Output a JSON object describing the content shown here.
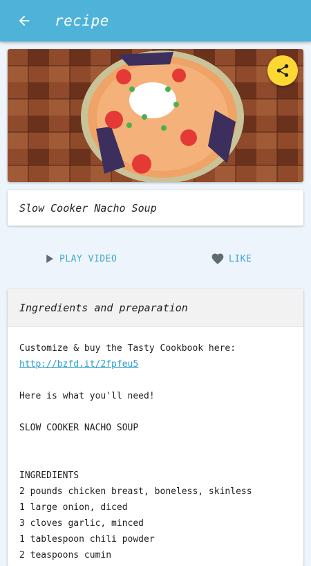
{
  "appbar": {
    "title": "recipe",
    "back_icon": "arrow-back-icon"
  },
  "hero": {
    "alt_subject": "nacho soup bowl photo",
    "share_icon": "share-icon"
  },
  "recipe": {
    "title": "Slow Cooker Nacho Soup"
  },
  "actions": {
    "play_label": "PLAY VIDEO",
    "like_label": "LIKE"
  },
  "card": {
    "header": "Ingredients and preparation",
    "intro": "Customize & buy the Tasty Cookbook here:",
    "link": "http://bzfd.it/2fpfeu5",
    "need": "Here is what you'll need!",
    "name_caps": "SLOW COOKER NACHO SOUP",
    "ingredients_heading": "INGREDIENTS",
    "ingredients": [
      "2 pounds chicken breast, boneless, skinless",
      "1 large onion, diced",
      "3 cloves garlic, minced",
      "1 tablespoon chili powder",
      "2 teaspoons cumin"
    ]
  },
  "colors": {
    "appbar": "#4fb3d9",
    "accent": "#3fa7cf",
    "fab": "#fdd835",
    "background": "#eef4fb"
  }
}
